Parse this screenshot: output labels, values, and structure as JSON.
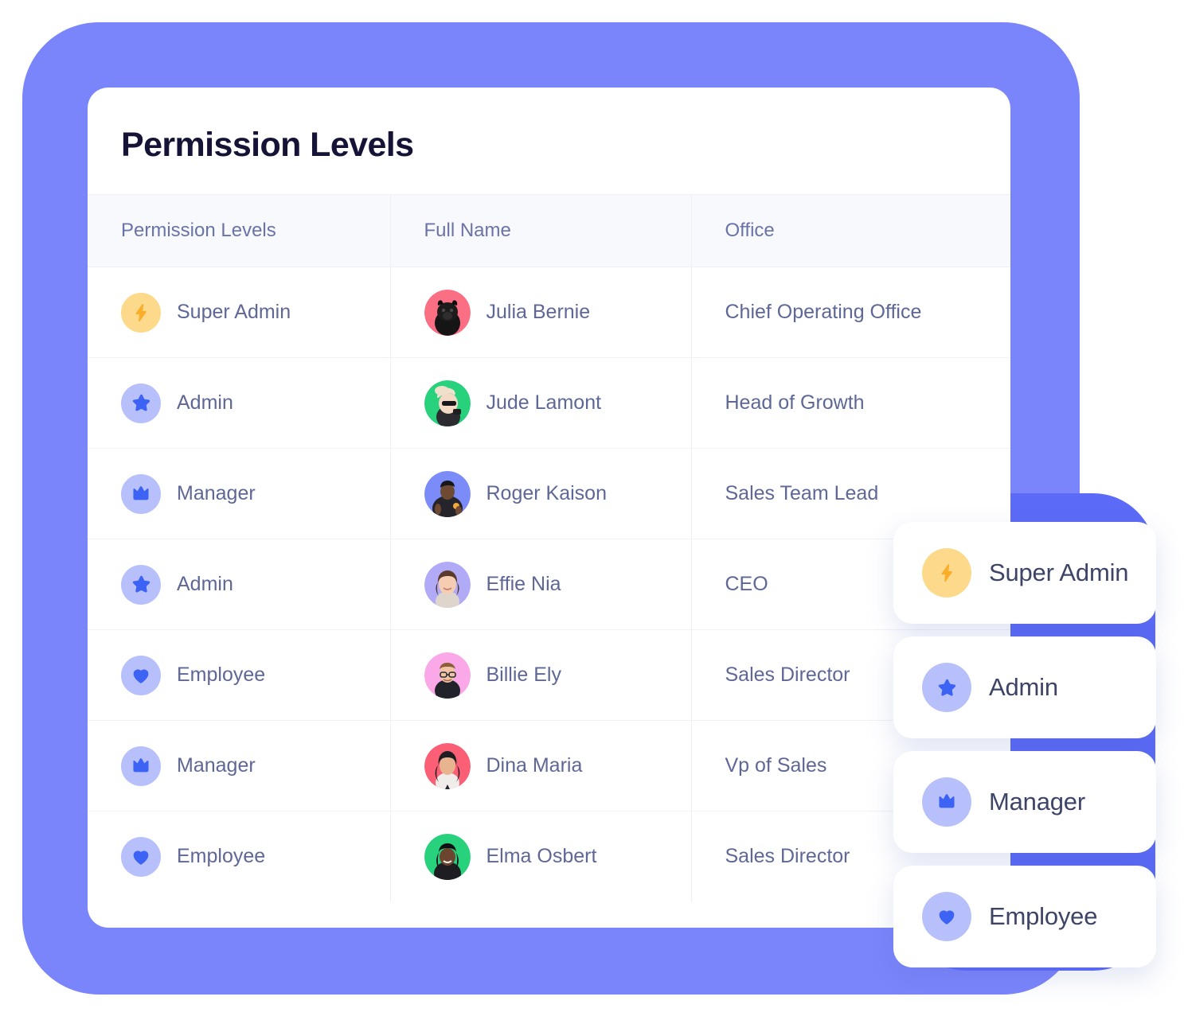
{
  "theme": {
    "backdrop_blue": "#7b85fb",
    "backdrop_blue_dark": "#5c6bf7",
    "card_white": "#ffffff",
    "title_color": "#151336",
    "table_text": "#5e6795",
    "header_text": "#6a73a8",
    "badge_amber": "#fcd98b",
    "badge_periwinkle": "#b7c0fb",
    "icon_blue": "#3d63f5",
    "icon_amber": "#f9ad28"
  },
  "card": {
    "title": "Permission Levels"
  },
  "table": {
    "columns": [
      {
        "key": "permission_level",
        "label": "Permission Levels"
      },
      {
        "key": "full_name",
        "label": "Full Name"
      },
      {
        "key": "office",
        "label": "Office"
      }
    ],
    "rows": [
      {
        "permission_level": "Super Admin",
        "icon": "lightning-bolt-icon",
        "badge_style": "rb-super",
        "full_name": "Julia Bernie",
        "avatar": "avatar-black-pug-pink",
        "office": "Chief Operating Office"
      },
      {
        "permission_level": "Admin",
        "icon": "star-icon",
        "badge_style": "rb-admin",
        "full_name": "Jude Lamont",
        "avatar": "avatar-sunglasses-green",
        "office": "Head of Growth"
      },
      {
        "permission_level": "Manager",
        "icon": "crown-icon",
        "badge_style": "rb-manager",
        "full_name": "Roger Kaison",
        "avatar": "avatar-man-blue",
        "office": "Sales Team Lead"
      },
      {
        "permission_level": "Admin",
        "icon": "star-icon",
        "badge_style": "rb-admin",
        "full_name": "Effie Nia",
        "avatar": "avatar-woman-lavender",
        "office": "CEO"
      },
      {
        "permission_level": "Employee",
        "icon": "heart-icon",
        "badge_style": "rb-employee",
        "full_name": "Billie Ely",
        "avatar": "avatar-man-glasses-pink",
        "office": "Sales Director"
      },
      {
        "permission_level": "Manager",
        "icon": "crown-icon",
        "badge_style": "rb-manager",
        "full_name": "Dina Maria",
        "avatar": "avatar-woman-coral",
        "office": "Vp of Sales"
      },
      {
        "permission_level": "Employee",
        "icon": "heart-icon",
        "badge_style": "rb-employee",
        "full_name": "Elma Osbert",
        "avatar": "avatar-woman-green",
        "office": "Sales Director"
      }
    ]
  },
  "floating_cards": [
    {
      "label": "Super Admin",
      "icon": "lightning-bolt-icon",
      "badge_style": "rb-super"
    },
    {
      "label": "Admin",
      "icon": "star-icon",
      "badge_style": "rb-admin"
    },
    {
      "label": "Manager",
      "icon": "crown-icon",
      "badge_style": "rb-manager"
    },
    {
      "label": "Employee",
      "icon": "heart-icon",
      "badge_style": "rb-employee"
    }
  ]
}
